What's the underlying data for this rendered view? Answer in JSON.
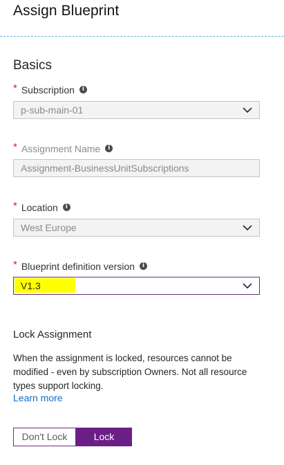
{
  "header": {
    "title": "Assign Blueprint"
  },
  "section": {
    "title": "Basics"
  },
  "fields": {
    "subscription": {
      "label": "Subscription",
      "value": "p-sub-main-01",
      "required_mark": "*"
    },
    "assignment_name": {
      "label": "Assignment Name",
      "value": "Assignment-BusinessUnitSubscriptions",
      "required_mark": "*"
    },
    "location": {
      "label": "Location",
      "value": "West Europe",
      "required_mark": "*"
    },
    "blueprint_version": {
      "label": "Blueprint definition version",
      "value": "V1.3",
      "required_mark": "*"
    }
  },
  "lock": {
    "heading": "Lock Assignment",
    "description": "When the assignment is locked, resources cannot be modified - even by subscription Owners. Not all resource types support locking.",
    "learn_more": "Learn more",
    "options": [
      "Don't Lock",
      "Lock"
    ],
    "selected": "Lock"
  },
  "icons": {
    "info": "info-icon",
    "chevron": "chevron-down-icon"
  },
  "colors": {
    "accent": "#6b1f86",
    "required": "#c5282b",
    "link": "#0e6ec6",
    "highlight": "#ffff00",
    "divider": "#5fb4d8"
  }
}
